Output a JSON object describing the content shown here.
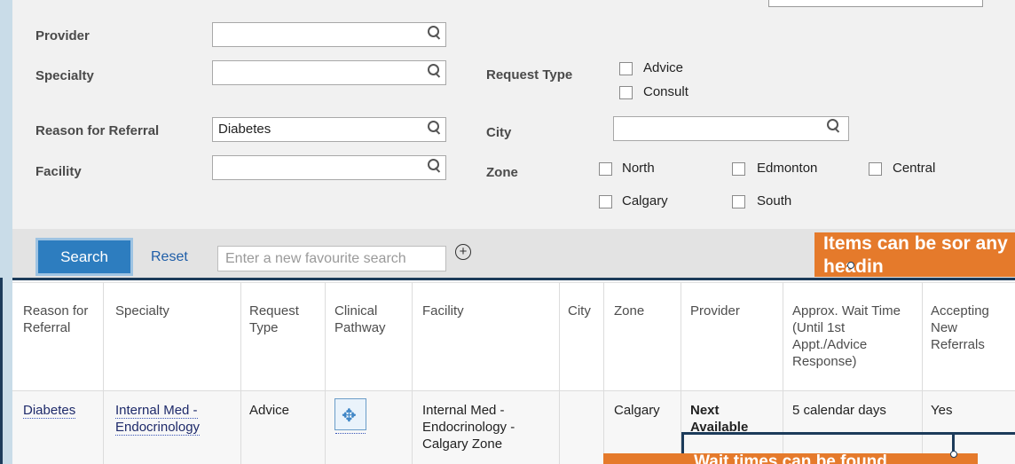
{
  "filters": {
    "provider_label": "Provider",
    "provider_value": "",
    "specialty_label": "Specialty",
    "specialty_value": "",
    "reason_label": "Reason for Referral",
    "reason_value": "Diabetes",
    "facility_label": "Facility",
    "facility_value": "",
    "request_type_label": "Request Type",
    "request_type_options": [
      "Advice",
      "Consult"
    ],
    "city_label": "City",
    "city_value": "",
    "zone_label": "Zone",
    "zone_options": [
      "North",
      "Edmonton",
      "Central",
      "Calgary",
      "South"
    ]
  },
  "actions": {
    "search_label": "Search",
    "reset_label": "Reset",
    "favourite_placeholder": "Enter a new favourite search",
    "add_favourite_symbol": "+"
  },
  "table": {
    "headers": [
      "Reason for Referral",
      "Specialty",
      "Request Type",
      "Clinical Pathway",
      "Facility",
      "City",
      "Zone",
      "Provider",
      "Approx. Wait Time (Until 1st Appt./Advice Response)",
      "Accepting New Referrals"
    ],
    "rows": [
      {
        "reason": "Diabetes",
        "specialty": "Internal Med - Endocrinology",
        "request_type": "Advice",
        "facility": "Internal Med - Endocrinology - Calgary Zone",
        "city": "",
        "zone": "Calgary",
        "provider": "Next Available",
        "wait_time": "5 calendar days",
        "accepting": "Yes"
      }
    ]
  },
  "callouts": {
    "sort_note": "Items can be sor any headin",
    "bottom_note": "Wait times can be found"
  },
  "colors": {
    "accent": "#2d7dbf",
    "callout": "#e57a2b",
    "panel": "#f1f1f1"
  }
}
